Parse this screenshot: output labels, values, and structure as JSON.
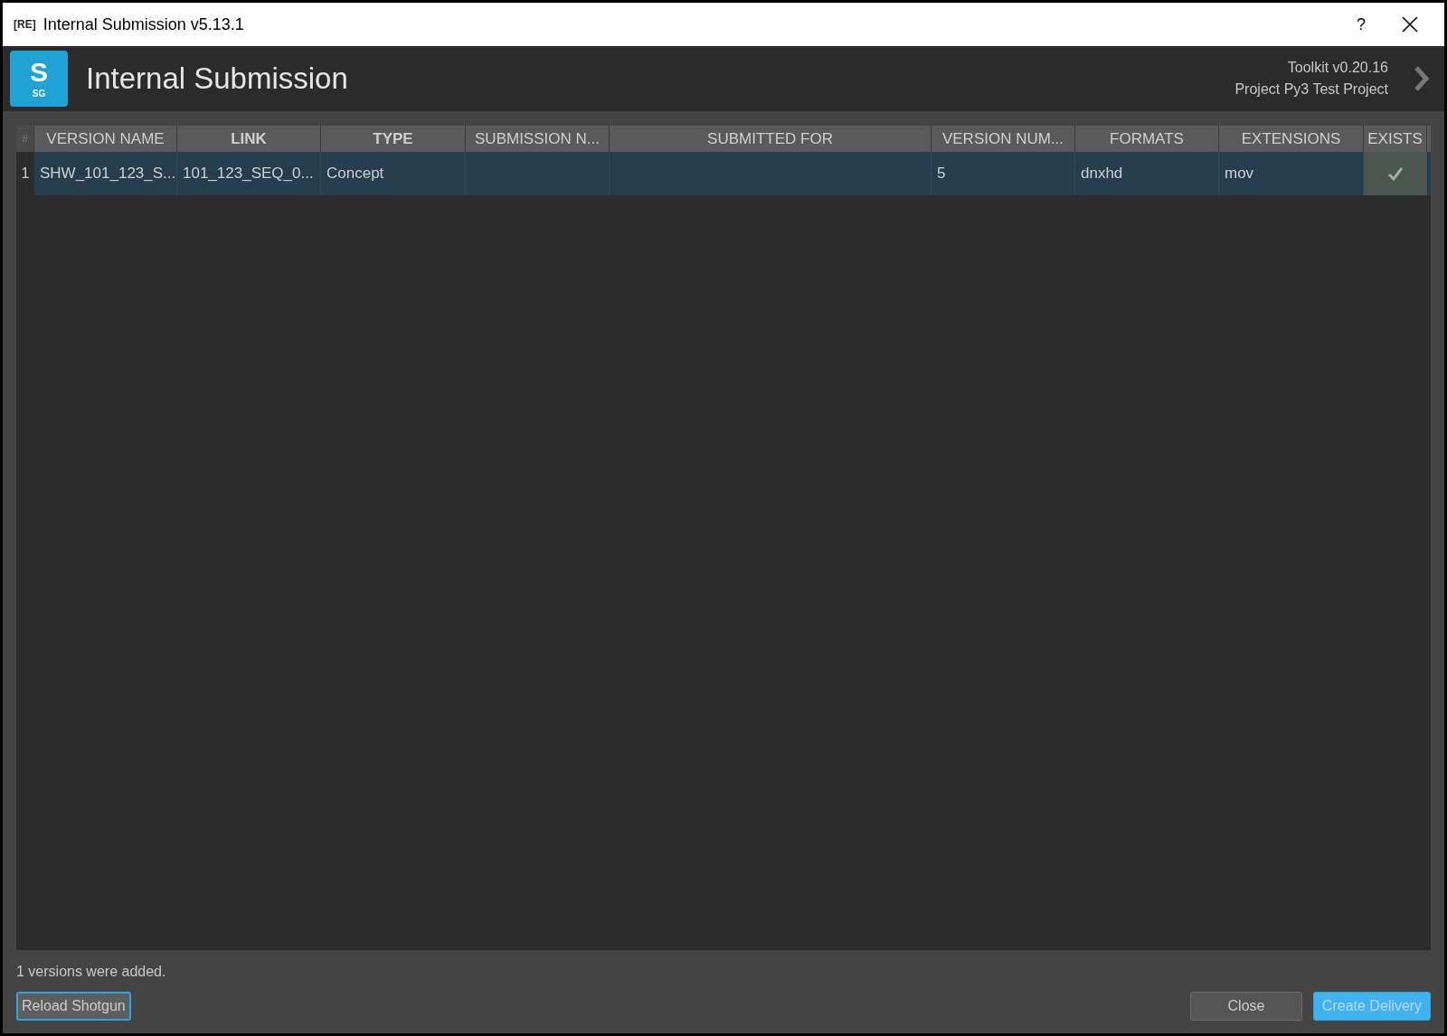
{
  "window": {
    "badge": "[RE]",
    "title": "Internal Submission v5.13.1",
    "help": "?"
  },
  "header": {
    "app_title": "Internal Submission",
    "logo_letter": "S",
    "logo_sub": "SG",
    "toolkit": "Toolkit v0.20.16",
    "project": "Project Py3 Test Project"
  },
  "table": {
    "corner": "#",
    "columns": [
      {
        "label": "VERSION NAME",
        "bold": false
      },
      {
        "label": "LINK",
        "bold": true
      },
      {
        "label": "TYPE",
        "bold": true
      },
      {
        "label": "SUBMISSION N...",
        "bold": false
      },
      {
        "label": "SUBMITTED FOR",
        "bold": false
      },
      {
        "label": "VERSION NUM...",
        "bold": false
      },
      {
        "label": "FORMATS",
        "bold": false
      },
      {
        "label": "EXTENSIONS",
        "bold": false
      },
      {
        "label": "EXISTS",
        "bold": false
      }
    ],
    "rows": [
      {
        "number": "1",
        "selected": true,
        "cells": [
          "SHW_101_123_S...",
          "101_123_SEQ_0...",
          "Concept",
          "",
          "",
          "5",
          "dnxhd",
          "mov"
        ],
        "exists": true
      }
    ]
  },
  "status": "1 versions were added.",
  "buttons": {
    "reload": "Reload Shotgun",
    "close": "Close",
    "create": "Create Delivery"
  }
}
